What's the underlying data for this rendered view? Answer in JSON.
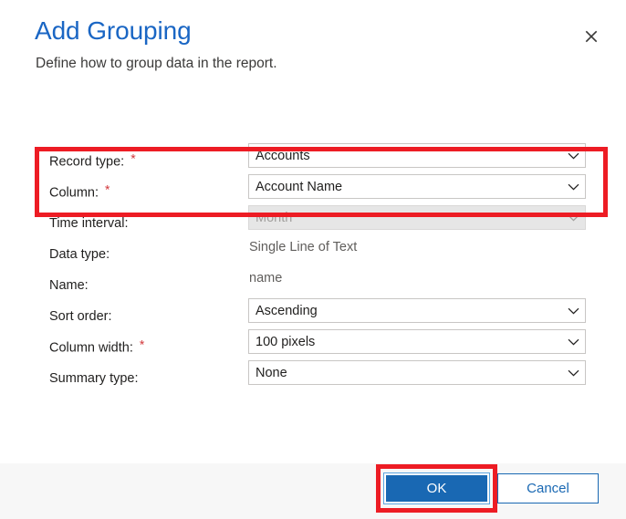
{
  "dialog": {
    "title": "Add Grouping",
    "subtitle": "Define how to group data in the report.",
    "close_icon": "close-icon"
  },
  "form": {
    "rows": [
      {
        "label": "Record type:",
        "required": true,
        "asterisk": "*",
        "control": "dropdown",
        "value": "Accounts",
        "disabled": false
      },
      {
        "label": "Column:",
        "required": true,
        "asterisk": "*",
        "control": "dropdown",
        "value": "Account Name",
        "disabled": false
      },
      {
        "label": "Time interval:",
        "required": false,
        "asterisk": "",
        "control": "dropdown",
        "value": "Month",
        "disabled": true
      },
      {
        "label": "Data type:",
        "required": false,
        "asterisk": "",
        "control": "text",
        "value": "Single Line of Text",
        "disabled": false
      },
      {
        "label": "Name:",
        "required": false,
        "asterisk": "",
        "control": "text",
        "value": "name",
        "disabled": false
      },
      {
        "label": "Sort order:",
        "required": false,
        "asterisk": "",
        "control": "dropdown",
        "value": "Ascending",
        "disabled": false
      },
      {
        "label": "Column width:",
        "required": true,
        "asterisk": "*",
        "control": "dropdown",
        "value": "100 pixels",
        "disabled": false
      },
      {
        "label": "Summary type:",
        "required": false,
        "asterisk": "",
        "control": "dropdown",
        "value": "None",
        "disabled": false
      }
    ]
  },
  "footer": {
    "ok_label": "OK",
    "cancel_label": "Cancel"
  },
  "colors": {
    "title_blue": "#1a66c4",
    "primary_button": "#1968b3",
    "annotation_red": "#ed1c24",
    "required_asterisk": "#d13438",
    "footer_background": "#f7f7f7",
    "disabled_field": "#e6e6e6"
  }
}
